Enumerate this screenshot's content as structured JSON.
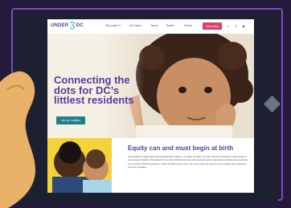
{
  "site": {
    "logo": {
      "pre": "UNDER",
      "num": "3",
      "post": "DC"
    },
    "nav_items": [
      "Why Under 3",
      "Our Vision",
      "News",
      "Events",
      "Stories"
    ],
    "cta_label": "Take Action",
    "social_icons": [
      "facebook-icon",
      "twitter-icon",
      "youtube-icon"
    ],
    "hero": {
      "title": "Connecting the dots for DC’s littlest residents",
      "button_label": "Join our coalition"
    },
    "equity": {
      "title": "Equity can and must begin at birth",
      "body": "The benefits of a high-quality early education last a lifetime. Yet today, too many, too many infants are denied the opportunities of our youngest residents. Throughout DC, the early childhood services and programs remain inaccessible to families that need them most. And the COVID-19 pandemic makes everything even worse. As a community, we must do more to reduce these racial and economic inequities."
    }
  },
  "colors": {
    "brand_purple": "#5b3b9b",
    "accent_pink": "#e23d6a",
    "teal": "#1f7d8c",
    "logo_teal": "#29b6c8",
    "backdrop": "#241a3c",
    "panel": "#1c2030"
  }
}
